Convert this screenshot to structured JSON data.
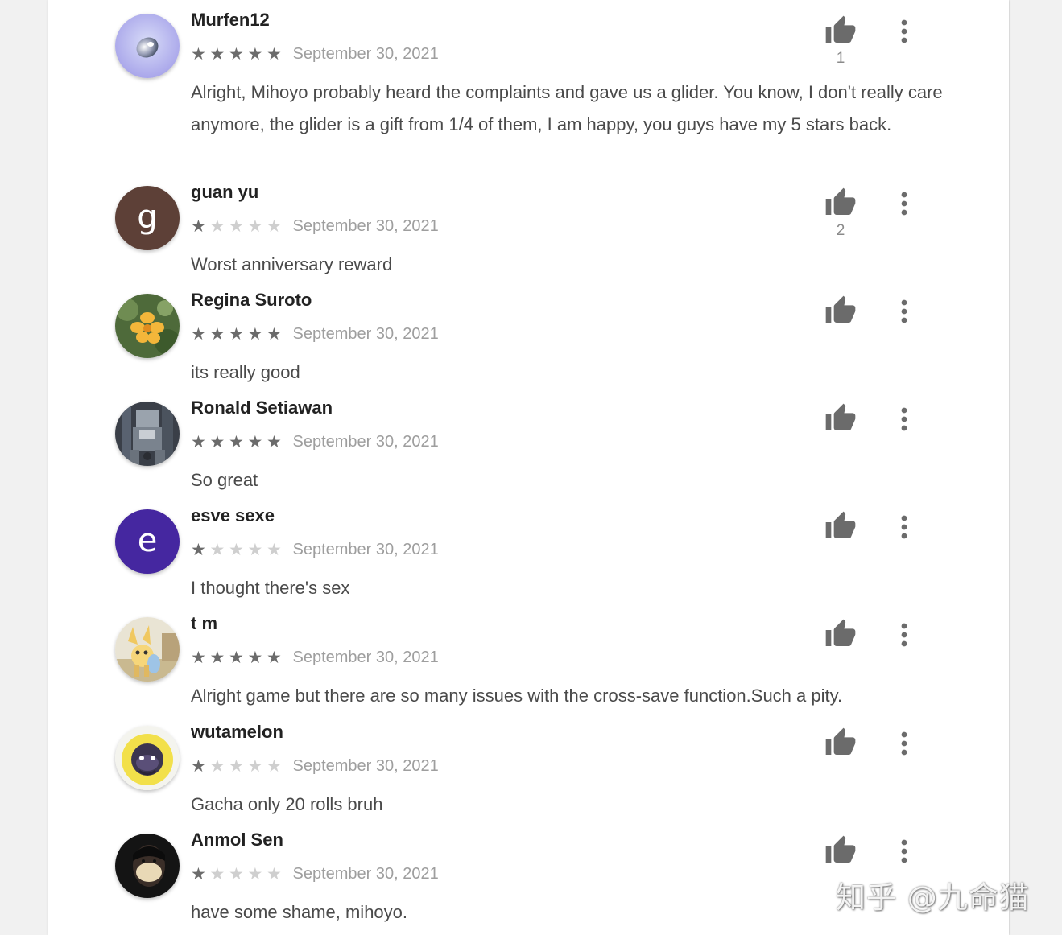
{
  "colors": {
    "star_on": "#6b6b6b",
    "star_off": "#cfcfcf",
    "author": "#222222",
    "date": "#9e9e9e",
    "body": "#4a4a4a",
    "icon": "#6b6b6b"
  },
  "reviews": [
    {
      "author": "Murfen12",
      "rating": 5,
      "date": "September 30, 2021",
      "text": "Alright, Mihoyo probably heard the complaints and gave us a glider. You know, I don't really care anymore, the glider is a gift from 1/4 of them, I am happy, you guys have my 5 stars back.",
      "helpful_count": "1",
      "avatar": {
        "type": "image",
        "icon": "silver-orb-avatar"
      }
    },
    {
      "author": "guan yu",
      "rating": 1,
      "date": "September 30, 2021",
      "text": "Worst anniversary reward",
      "helpful_count": "2",
      "avatar": {
        "type": "letter",
        "letter": "g",
        "color": "#5d4037"
      }
    },
    {
      "author": "Regina Suroto",
      "rating": 5,
      "date": "September 30, 2021",
      "text": "its really good",
      "helpful_count": "",
      "avatar": {
        "type": "image",
        "icon": "yellow-flower-avatar"
      }
    },
    {
      "author": "Ronald Setiawan",
      "rating": 5,
      "date": "September 30, 2021",
      "text": "So great",
      "helpful_count": "",
      "avatar": {
        "type": "image",
        "icon": "robot-statue-avatar"
      }
    },
    {
      "author": "esve sexe",
      "rating": 1,
      "date": "September 30, 2021",
      "text": "I thought there's sex",
      "helpful_count": "",
      "avatar": {
        "type": "letter",
        "letter": "e",
        "color": "#4527a0"
      }
    },
    {
      "author": "t m",
      "rating": 5,
      "date": "September 30, 2021",
      "text": "Alright game but there are so many issues with the cross-save function.Such a pity.",
      "helpful_count": "",
      "avatar": {
        "type": "image",
        "icon": "cartoon-creature-avatar"
      }
    },
    {
      "author": "wutamelon",
      "rating": 1,
      "date": "September 30, 2021",
      "text": "Gacha only 20 rolls bruh",
      "helpful_count": "",
      "avatar": {
        "type": "image",
        "icon": "yellow-mascot-avatar"
      }
    },
    {
      "author": "Anmol Sen",
      "rating": 1,
      "date": "September 30, 2021",
      "text": "have some shame, mihoyo.",
      "helpful_count": "",
      "avatar": {
        "type": "image",
        "icon": "masked-person-avatar"
      }
    }
  ],
  "icons": {
    "thumb": "thumbs-up-icon",
    "more": "more-vertical-icon",
    "star": "star-icon"
  },
  "watermark": "知乎 @九命猫"
}
